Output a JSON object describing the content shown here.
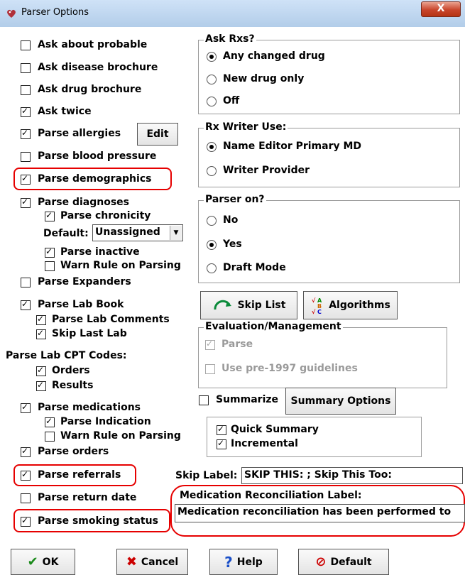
{
  "window": {
    "title": "Parser Options",
    "close_label": "X"
  },
  "left_checks": [
    {
      "label": "Ask about probable",
      "checked": false
    },
    {
      "label": "Ask disease brochure",
      "checked": false
    },
    {
      "label": "Ask drug brochure",
      "checked": false
    },
    {
      "label": "Ask twice",
      "checked": true
    },
    {
      "label": "Parse allergies",
      "checked": true
    },
    {
      "label": "Parse blood pressure",
      "checked": false
    },
    {
      "label": "Parse demographics",
      "checked": true
    },
    {
      "label": "Parse diagnoses",
      "checked": true
    }
  ],
  "allergies_edit_label": "Edit",
  "diagnoses_sub": {
    "chronicity": {
      "label": "Parse chronicity",
      "checked": true
    },
    "default_label": "Default:",
    "default_value": "Unassigned",
    "inactive": {
      "label": "Parse inactive",
      "checked": true
    },
    "warn_rule": {
      "label": "Warn Rule on Parsing",
      "checked": false
    }
  },
  "expanders": {
    "label": "Parse Expanders",
    "checked": false
  },
  "lab_book": {
    "label": "Parse Lab Book",
    "checked": true
  },
  "lab_comments": {
    "label": "Parse Lab Comments",
    "checked": true
  },
  "skip_last_lab": {
    "label": "Skip Last Lab",
    "checked": true
  },
  "lab_cpt_heading": "Parse Lab CPT Codes:",
  "orders_cpt": {
    "label": "Orders",
    "checked": true
  },
  "results_cpt": {
    "label": "Results",
    "checked": true
  },
  "medications": {
    "label": "Parse medications",
    "checked": true
  },
  "indication": {
    "label": "Parse Indication",
    "checked": true
  },
  "med_warn_rule": {
    "label": "Warn Rule on Parsing",
    "checked": false
  },
  "parse_orders": {
    "label": "Parse orders",
    "checked": true
  },
  "referrals": {
    "label": "Parse referrals",
    "checked": true
  },
  "return_date": {
    "label": "Parse return date",
    "checked": false
  },
  "smoking": {
    "label": "Parse smoking status",
    "checked": true
  },
  "ask_rxs": {
    "title": "Ask Rxs?",
    "options": [
      {
        "label": "Any changed drug",
        "checked": true
      },
      {
        "label": "New drug only",
        "checked": false
      },
      {
        "label": "Off",
        "checked": false
      }
    ]
  },
  "rx_writer": {
    "title": "Rx Writer Use:",
    "options": [
      {
        "label": "Name Editor Primary MD",
        "checked": true
      },
      {
        "label": "Writer Provider",
        "checked": false
      }
    ]
  },
  "parser_on": {
    "title": "Parser on?",
    "options": [
      {
        "label": "No",
        "checked": false
      },
      {
        "label": "Yes",
        "checked": true
      },
      {
        "label": "Draft Mode",
        "checked": false
      }
    ]
  },
  "skip_list_label": "Skip List",
  "algorithms_label": "Algorithms",
  "em_group": {
    "title": "Evaluation/Management",
    "parse": {
      "label": "Parse",
      "checked": true
    },
    "pre1997": {
      "label": "Use pre-1997 guidelines",
      "checked": false
    }
  },
  "summarize": {
    "label": "Summarize",
    "checked": false
  },
  "summary_options_label": "Summary Options",
  "quick_summary": {
    "label": "Quick Summary",
    "checked": true
  },
  "incremental": {
    "label": "Incremental",
    "checked": true
  },
  "skip_label": {
    "label": "Skip Label:",
    "value": "SKIP THIS: ; Skip This Too:"
  },
  "med_rec": {
    "label": "Medication Reconciliation Label:",
    "value": "Medication reconciliation has been performed to"
  },
  "buttons": {
    "ok": "OK",
    "cancel": "Cancel",
    "help": "Help",
    "default": "Default"
  },
  "colors": {
    "highlight": "#e60000",
    "titlebar": "#b9d3ee",
    "close": "#c8452b"
  }
}
